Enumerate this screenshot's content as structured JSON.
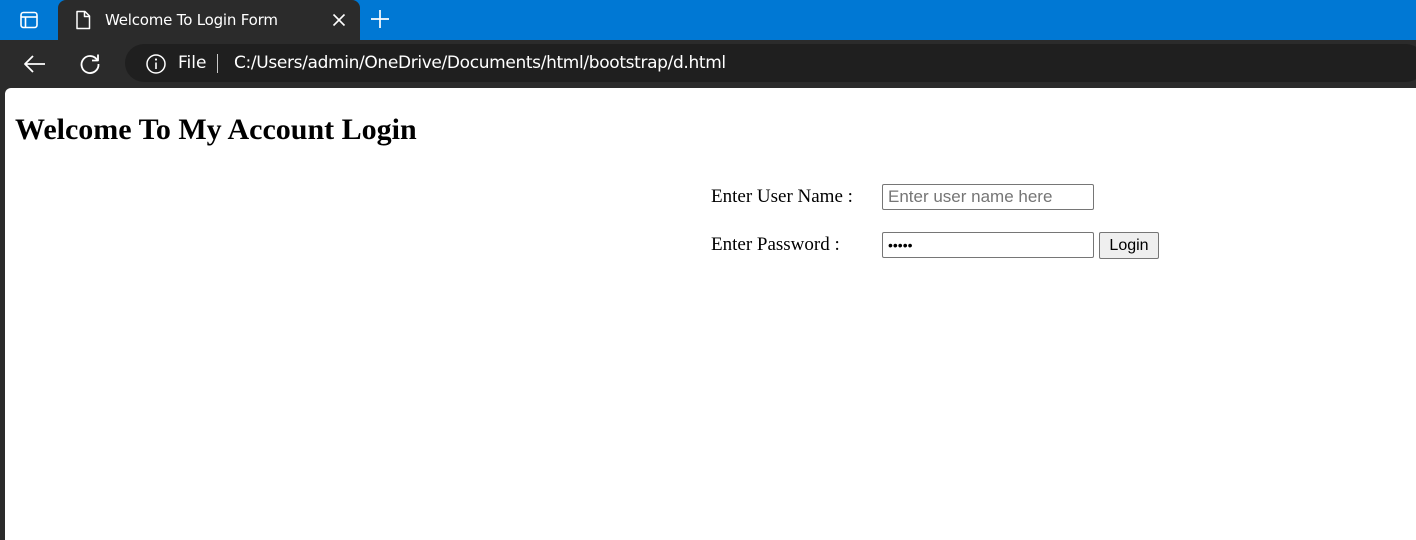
{
  "browser": {
    "tab": {
      "title": "Welcome To Login Form",
      "favicon": "page-icon"
    },
    "address_bar": {
      "scheme_label": "File",
      "url": "C:/Users/admin/OneDrive/Documents/html/bootstrap/d.html"
    },
    "icons": {
      "tab_actions": "tab-actions-icon",
      "close": "close-icon",
      "new_tab": "plus-icon",
      "back": "back-arrow-icon",
      "reload": "reload-icon",
      "site_info": "info-icon"
    },
    "colors": {
      "tabstrip": "#0078d4",
      "chrome": "#2b2b2b",
      "addressbar": "#1f1f1f"
    }
  },
  "page": {
    "heading": "Welcome To My Account Login",
    "form": {
      "username_label": "Enter User Name :",
      "username_placeholder": "Enter user name here",
      "username_value": "",
      "password_label": "Enter Password :",
      "password_value": "•••••",
      "login_button": "Login"
    }
  }
}
